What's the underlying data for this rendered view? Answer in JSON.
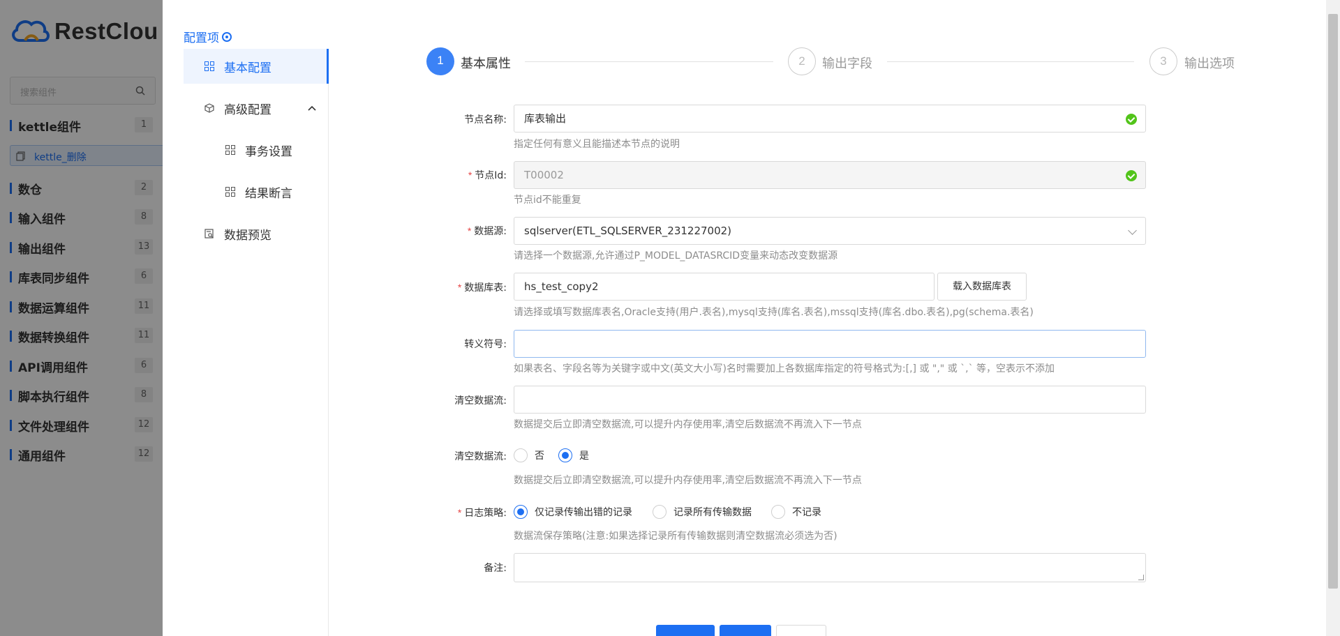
{
  "background": {
    "brand": "RestClou",
    "search_placeholder": "搜索组件",
    "categories": [
      {
        "name": "kettle组件",
        "count": "1"
      },
      {
        "name": "数仓",
        "count": "2"
      },
      {
        "name": "输入组件",
        "count": "8"
      },
      {
        "name": "输出组件",
        "count": "13"
      },
      {
        "name": "库表同步组件",
        "count": "6"
      },
      {
        "name": "数据运算组件",
        "count": "11"
      },
      {
        "name": "数据转换组件",
        "count": "11"
      },
      {
        "name": "API调用组件",
        "count": "6"
      },
      {
        "name": "脚本执行组件",
        "count": "8"
      },
      {
        "name": "文件处理组件",
        "count": "12"
      },
      {
        "name": "通用组件",
        "count": "12"
      }
    ],
    "sub_item": "kettle_删除"
  },
  "nav": {
    "header": "配置项",
    "items": {
      "basic": "基本配置",
      "advanced": "高级配置",
      "transaction": "事务设置",
      "assert": "结果断言",
      "preview": "数据预览"
    }
  },
  "steps": [
    {
      "num": "1",
      "label": "基本属性"
    },
    {
      "num": "2",
      "label": "输出字段"
    },
    {
      "num": "3",
      "label": "输出选项"
    }
  ],
  "form": {
    "node_name": {
      "label": "节点名称:",
      "value": "库表输出",
      "help": "指定任何有意义且能描述本节点的说明"
    },
    "node_id": {
      "label": "节点Id:",
      "value": "T00002",
      "help": "节点id不能重复"
    },
    "datasource": {
      "label": "数据源:",
      "value": "sqlserver(ETL_SQLSERVER_231227002)",
      "help": "请选择一个数据源,允许通过P_MODEL_DATASRCID变量来动态改变数据源"
    },
    "table": {
      "label": "数据库表:",
      "value": "hs_test_copy2",
      "button": "载入数据库表",
      "help": "请选择或填写数据库表名,Oracle支持(用户.表名),mysql支持(库名.表名),mssql支持(库名.dbo.表名),pg(schema.表名)"
    },
    "escape": {
      "label": "转义符号:",
      "value": "",
      "help": "如果表名、字段名等为关键字或中文(英文大小写)名时需要加上各数据库指定的符号格式为:[,] 或 \",\" 或 `,` 等，空表示不添加"
    },
    "clear_stream_input": {
      "label": "清空数据流:",
      "value": "",
      "help": "数据提交后立即清空数据流,可以提升内存使用率,清空后数据流不再流入下一节点"
    },
    "clear_stream_radio": {
      "label": "清空数据流:",
      "options": [
        "否",
        "是"
      ],
      "selected": "是",
      "help": "数据提交后立即清空数据流,可以提升内存使用率,清空后数据流不再流入下一节点"
    },
    "log_policy": {
      "label": "日志策略:",
      "options": [
        "仅记录传输出错的记录",
        "记录所有传输数据",
        "不记录"
      ],
      "selected": "仅记录传输出错的记录",
      "help": "数据流保存策略(注意:如果选择记录所有传输数据则清空数据流必须选为否)"
    },
    "remark": {
      "label": "备注:",
      "value": ""
    }
  },
  "colors": {
    "primary": "#1d6ff2",
    "success": "#52c41a",
    "required": "#e54545"
  }
}
